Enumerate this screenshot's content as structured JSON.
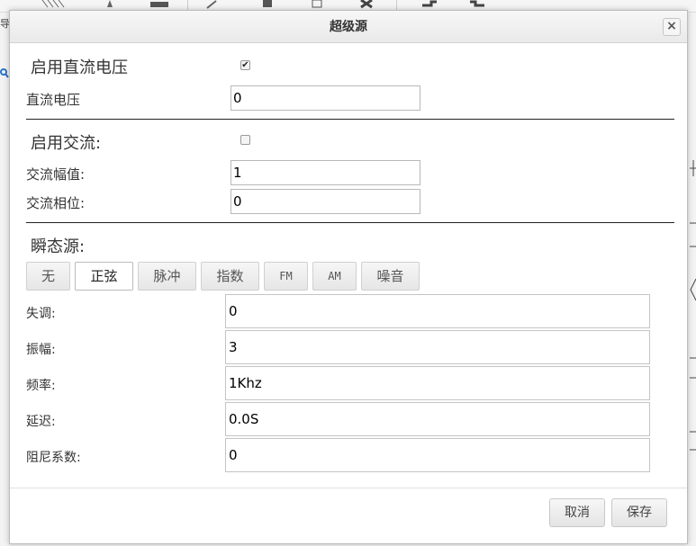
{
  "dialog": {
    "title": "超级源",
    "close_glyph": "×"
  },
  "dc": {
    "enable_label": "启用直流电压",
    "enabled": true,
    "voltage_label": "直流电压",
    "voltage_value": "0"
  },
  "ac": {
    "enable_label": "启用交流:",
    "enabled": false,
    "amplitude_label": "交流幅值:",
    "amplitude_value": "1",
    "phase_label": "交流相位:",
    "phase_value": "0"
  },
  "transient": {
    "section_label": "瞬态源:",
    "tabs": [
      {
        "label": "无",
        "active": false
      },
      {
        "label": "正弦",
        "active": true
      },
      {
        "label": "脉冲",
        "active": false
      },
      {
        "label": "指数",
        "active": false
      },
      {
        "label": "FM",
        "active": false
      },
      {
        "label": "AM",
        "active": false
      },
      {
        "label": "噪音",
        "active": false
      }
    ],
    "fields": [
      {
        "label": "失调:",
        "value": "0"
      },
      {
        "label": "振幅:",
        "value": "3"
      },
      {
        "label": "频率:",
        "value": "1Khz"
      },
      {
        "label": "延迟:",
        "value": "0.0S"
      },
      {
        "label": "阻尼系数:",
        "value": "0"
      }
    ]
  },
  "buttons": {
    "cancel": "取消",
    "save": "保存"
  },
  "background": {
    "left_label": "导"
  },
  "icons": {
    "close": "close-icon",
    "check": "check-icon"
  }
}
